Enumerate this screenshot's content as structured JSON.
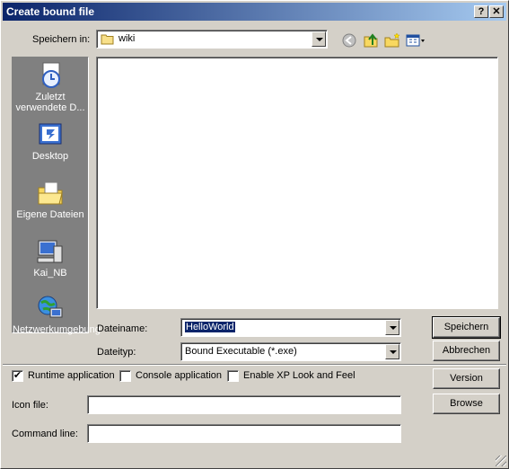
{
  "window": {
    "title": "Create bound file",
    "help_button": "?",
    "close_button": "✕"
  },
  "location": {
    "label": "Speichern in:",
    "current_folder": "wiki"
  },
  "toolbar": {
    "icons": [
      "back-icon",
      "up-folder-icon",
      "new-folder-icon",
      "view-menu-icon"
    ]
  },
  "places": [
    {
      "label": "Zuletzt verwendete D...",
      "icon": "recent-documents-icon"
    },
    {
      "label": "Desktop",
      "icon": "desktop-icon"
    },
    {
      "label": "Eigene Dateien",
      "icon": "my-documents-icon"
    },
    {
      "label": "Kai_NB",
      "icon": "computer-icon"
    },
    {
      "label": "Netzwerkumgebung",
      "icon": "network-icon"
    }
  ],
  "filename": {
    "label": "Dateiname:",
    "value": "HelloWorld"
  },
  "filetype": {
    "label": "Dateityp:",
    "value": "Bound Executable (*.exe)"
  },
  "buttons": {
    "save": "Speichern",
    "cancel": "Abbrechen",
    "version": "Version",
    "browse": "Browse"
  },
  "options": [
    {
      "label": "Runtime application",
      "checked": true
    },
    {
      "label": "Console application",
      "checked": false
    },
    {
      "label": "Enable XP Look and Feel",
      "checked": false
    }
  ],
  "icon_file": {
    "label": "Icon file:",
    "value": ""
  },
  "command_line": {
    "label": "Command line:",
    "value": ""
  }
}
